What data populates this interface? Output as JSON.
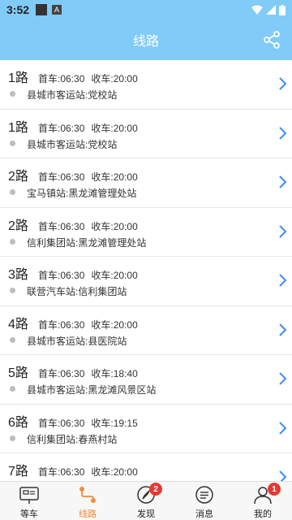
{
  "status": {
    "time": "3:52",
    "a_icon": "A"
  },
  "header": {
    "title": "线路"
  },
  "routes": [
    {
      "name": "1路",
      "first": "首车:06:30",
      "last": "收车:20:00",
      "stops": "县城市客运站:党校站"
    },
    {
      "name": "1路",
      "first": "首车:06:30",
      "last": "收车:20:00",
      "stops": "县城市客运站:党校站"
    },
    {
      "name": "2路",
      "first": "首车:06:30",
      "last": "收车:20:00",
      "stops": "宝马镇站:黑龙滩管理处站"
    },
    {
      "name": "2路",
      "first": "首车:06:30",
      "last": "收车:20:00",
      "stops": "信利集团站:黑龙滩管理处站"
    },
    {
      "name": "3路",
      "first": "首车:06:30",
      "last": "收车:20:00",
      "stops": "联营汽车站:信利集团站"
    },
    {
      "name": "4路",
      "first": "首车:06:30",
      "last": "收车:20:00",
      "stops": "县城市客运站:县医院站"
    },
    {
      "name": "5路",
      "first": "首车:06:30",
      "last": "收车:18:40",
      "stops": "县城市客运站:黑龙滩风景区站"
    },
    {
      "name": "6路",
      "first": "首车:06:30",
      "last": "收车:19:15",
      "stops": "信利集团站:春燕村站"
    },
    {
      "name": "7路",
      "first": "首车:06:30",
      "last": "收车:20:00",
      "stops": ""
    }
  ],
  "tabs": [
    {
      "label": "等车",
      "icon": "bus-stop-icon"
    },
    {
      "label": "线路",
      "icon": "route-icon",
      "active": true
    },
    {
      "label": "发现",
      "icon": "compass-icon",
      "badge": "2"
    },
    {
      "label": "消息",
      "icon": "message-icon"
    },
    {
      "label": "我的",
      "icon": "profile-icon",
      "badge": "1"
    }
  ],
  "colors": {
    "header": "#80cbf7",
    "accent": "#f08a3a",
    "arrow": "#3d8ef0",
    "badge": "#e53935"
  }
}
